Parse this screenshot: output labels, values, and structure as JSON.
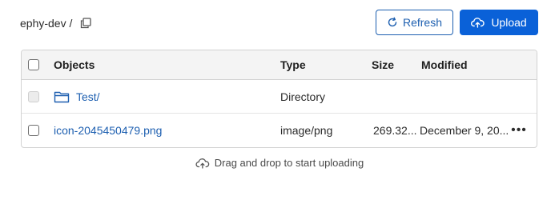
{
  "breadcrumb": {
    "bucket": "ephy-dev /",
    "copy_icon": "copy-icon"
  },
  "toolbar": {
    "refresh_label": "Refresh",
    "refresh_icon": "refresh-icon",
    "upload_label": "Upload",
    "upload_icon": "cloud-upload-icon"
  },
  "table": {
    "columns": [
      "Objects",
      "Type",
      "Size",
      "Modified"
    ],
    "rows": [
      {
        "name": "Test/",
        "type": "Directory",
        "size": "",
        "modified": "",
        "icon": "folder-icon",
        "checkbox_disabled": true
      },
      {
        "name": "icon-2045450479.png",
        "type": "image/png",
        "size": "269.32...",
        "modified": "December 9, 20...",
        "icon": "",
        "checkbox_disabled": false
      }
    ]
  },
  "drop_hint": {
    "text": "Drag and drop to start uploading",
    "icon": "cloud-upload-icon"
  },
  "colors": {
    "primary": "#0a61d8",
    "link": "#1d5fb0",
    "border": "#d2d2d2",
    "header_bg": "#f4f4f4"
  }
}
